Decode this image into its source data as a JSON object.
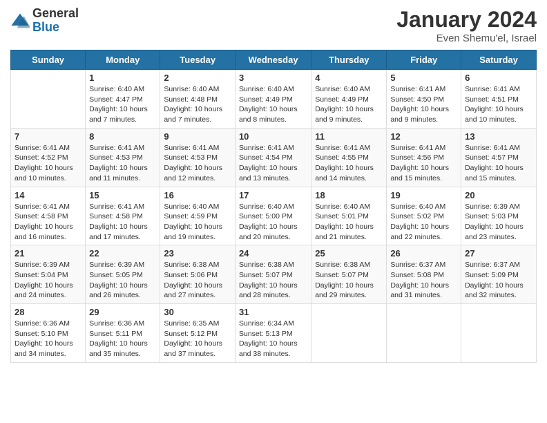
{
  "header": {
    "logo_general": "General",
    "logo_blue": "Blue",
    "title": "January 2024",
    "location": "Even Shemu'el, Israel"
  },
  "days_of_week": [
    "Sunday",
    "Monday",
    "Tuesday",
    "Wednesday",
    "Thursday",
    "Friday",
    "Saturday"
  ],
  "weeks": [
    [
      {
        "day": "",
        "info": ""
      },
      {
        "day": "1",
        "info": "Sunrise: 6:40 AM\nSunset: 4:47 PM\nDaylight: 10 hours and 7 minutes."
      },
      {
        "day": "2",
        "info": "Sunrise: 6:40 AM\nSunset: 4:48 PM\nDaylight: 10 hours and 7 minutes."
      },
      {
        "day": "3",
        "info": "Sunrise: 6:40 AM\nSunset: 4:49 PM\nDaylight: 10 hours and 8 minutes."
      },
      {
        "day": "4",
        "info": "Sunrise: 6:40 AM\nSunset: 4:49 PM\nDaylight: 10 hours and 9 minutes."
      },
      {
        "day": "5",
        "info": "Sunrise: 6:41 AM\nSunset: 4:50 PM\nDaylight: 10 hours and 9 minutes."
      },
      {
        "day": "6",
        "info": "Sunrise: 6:41 AM\nSunset: 4:51 PM\nDaylight: 10 hours and 10 minutes."
      }
    ],
    [
      {
        "day": "7",
        "info": "Sunrise: 6:41 AM\nSunset: 4:52 PM\nDaylight: 10 hours and 10 minutes."
      },
      {
        "day": "8",
        "info": "Sunrise: 6:41 AM\nSunset: 4:53 PM\nDaylight: 10 hours and 11 minutes."
      },
      {
        "day": "9",
        "info": "Sunrise: 6:41 AM\nSunset: 4:53 PM\nDaylight: 10 hours and 12 minutes."
      },
      {
        "day": "10",
        "info": "Sunrise: 6:41 AM\nSunset: 4:54 PM\nDaylight: 10 hours and 13 minutes."
      },
      {
        "day": "11",
        "info": "Sunrise: 6:41 AM\nSunset: 4:55 PM\nDaylight: 10 hours and 14 minutes."
      },
      {
        "day": "12",
        "info": "Sunrise: 6:41 AM\nSunset: 4:56 PM\nDaylight: 10 hours and 15 minutes."
      },
      {
        "day": "13",
        "info": "Sunrise: 6:41 AM\nSunset: 4:57 PM\nDaylight: 10 hours and 15 minutes."
      }
    ],
    [
      {
        "day": "14",
        "info": "Sunrise: 6:41 AM\nSunset: 4:58 PM\nDaylight: 10 hours and 16 minutes."
      },
      {
        "day": "15",
        "info": "Sunrise: 6:41 AM\nSunset: 4:58 PM\nDaylight: 10 hours and 17 minutes."
      },
      {
        "day": "16",
        "info": "Sunrise: 6:40 AM\nSunset: 4:59 PM\nDaylight: 10 hours and 19 minutes."
      },
      {
        "day": "17",
        "info": "Sunrise: 6:40 AM\nSunset: 5:00 PM\nDaylight: 10 hours and 20 minutes."
      },
      {
        "day": "18",
        "info": "Sunrise: 6:40 AM\nSunset: 5:01 PM\nDaylight: 10 hours and 21 minutes."
      },
      {
        "day": "19",
        "info": "Sunrise: 6:40 AM\nSunset: 5:02 PM\nDaylight: 10 hours and 22 minutes."
      },
      {
        "day": "20",
        "info": "Sunrise: 6:39 AM\nSunset: 5:03 PM\nDaylight: 10 hours and 23 minutes."
      }
    ],
    [
      {
        "day": "21",
        "info": "Sunrise: 6:39 AM\nSunset: 5:04 PM\nDaylight: 10 hours and 24 minutes."
      },
      {
        "day": "22",
        "info": "Sunrise: 6:39 AM\nSunset: 5:05 PM\nDaylight: 10 hours and 26 minutes."
      },
      {
        "day": "23",
        "info": "Sunrise: 6:38 AM\nSunset: 5:06 PM\nDaylight: 10 hours and 27 minutes."
      },
      {
        "day": "24",
        "info": "Sunrise: 6:38 AM\nSunset: 5:07 PM\nDaylight: 10 hours and 28 minutes."
      },
      {
        "day": "25",
        "info": "Sunrise: 6:38 AM\nSunset: 5:07 PM\nDaylight: 10 hours and 29 minutes."
      },
      {
        "day": "26",
        "info": "Sunrise: 6:37 AM\nSunset: 5:08 PM\nDaylight: 10 hours and 31 minutes."
      },
      {
        "day": "27",
        "info": "Sunrise: 6:37 AM\nSunset: 5:09 PM\nDaylight: 10 hours and 32 minutes."
      }
    ],
    [
      {
        "day": "28",
        "info": "Sunrise: 6:36 AM\nSunset: 5:10 PM\nDaylight: 10 hours and 34 minutes."
      },
      {
        "day": "29",
        "info": "Sunrise: 6:36 AM\nSunset: 5:11 PM\nDaylight: 10 hours and 35 minutes."
      },
      {
        "day": "30",
        "info": "Sunrise: 6:35 AM\nSunset: 5:12 PM\nDaylight: 10 hours and 37 minutes."
      },
      {
        "day": "31",
        "info": "Sunrise: 6:34 AM\nSunset: 5:13 PM\nDaylight: 10 hours and 38 minutes."
      },
      {
        "day": "",
        "info": ""
      },
      {
        "day": "",
        "info": ""
      },
      {
        "day": "",
        "info": ""
      }
    ]
  ]
}
